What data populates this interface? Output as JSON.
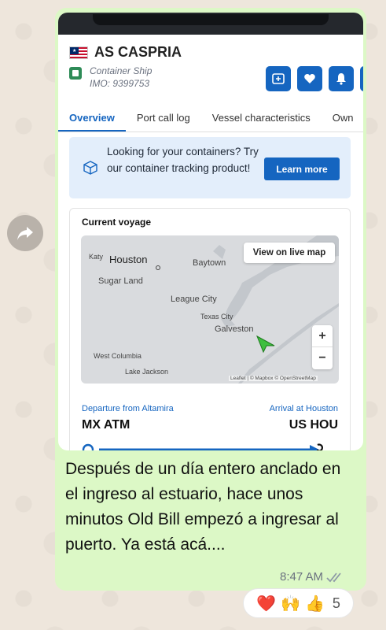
{
  "vessel": {
    "name": "AS CASPRIA",
    "type": "Container Ship",
    "imo": "IMO: 9399753"
  },
  "tabs": [
    "Overview",
    "Port call log",
    "Vessel characteristics",
    "Own"
  ],
  "promo": {
    "text": "Looking for your containers? Try our container tracking product!",
    "button": "Learn more"
  },
  "voyage": {
    "title": "Current voyage",
    "map": {
      "live_button": "View on live map",
      "labels": {
        "katy": "Katy",
        "houston": "Houston",
        "baytown": "Baytown",
        "sugar_land": "Sugar Land",
        "league_city": "League City",
        "texas_city": "Texas City",
        "galveston": "Galveston",
        "west_columbia": "West Columbia",
        "lake_jackson": "Lake Jackson"
      },
      "zoom_in": "+",
      "zoom_out": "−",
      "attribution": "Leaflet | © Mapbox © OpenStreetMap"
    },
    "departure_label": "Departure from Altamira",
    "departure_code": "MX ATM",
    "arrival_label": "Arrival at Houston",
    "arrival_code": "US HOU"
  },
  "message": {
    "text": "Después de un día entero anclado en el ingreso al estuario, hace unos minutos Old Bill empezó a ingresar al puerto. Ya está acá....",
    "time": "8:47 AM"
  },
  "reactions": {
    "emojis": [
      "❤️",
      "🙌",
      "👍"
    ],
    "count": "5"
  },
  "colors": {
    "bubble": "#dcf8c6",
    "accent": "#1565c0",
    "wallpaper": "#eee6dc",
    "read_ticks": "#8e9aa6"
  }
}
